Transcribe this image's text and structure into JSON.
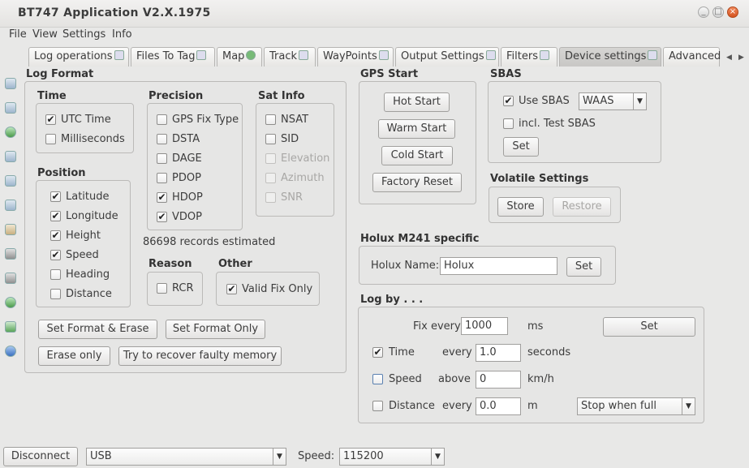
{
  "window": {
    "title": "BT747 Application V2.X.1975",
    "min": "_",
    "max": "□",
    "close": "×"
  },
  "menu": [
    "File",
    "View",
    "Settings",
    "Info"
  ],
  "tabs": [
    "Log operations",
    "Files To Tag",
    "Map",
    "Track",
    "WayPoints",
    "Output Settings",
    "Filters",
    "Device settings",
    "Advanced"
  ],
  "log_format": {
    "title": "Log Format",
    "time": {
      "title": "Time",
      "items": [
        {
          "label": "UTC Time",
          "checked": true
        },
        {
          "label": "Milliseconds",
          "checked": false
        }
      ]
    },
    "precision": {
      "title": "Precision",
      "items": [
        {
          "label": "GPS Fix Type",
          "checked": false
        },
        {
          "label": "DSTA",
          "checked": false
        },
        {
          "label": "DAGE",
          "checked": false
        },
        {
          "label": "PDOP",
          "checked": false
        },
        {
          "label": "HDOP",
          "checked": true
        },
        {
          "label": "VDOP",
          "checked": true
        }
      ]
    },
    "satinfo": {
      "title": "Sat Info",
      "items": [
        {
          "label": "NSAT",
          "checked": false,
          "disabled": false
        },
        {
          "label": "SID",
          "checked": false,
          "disabled": false
        },
        {
          "label": "Elevation",
          "checked": false,
          "disabled": true
        },
        {
          "label": "Azimuth",
          "checked": false,
          "disabled": true
        },
        {
          "label": "SNR",
          "checked": false,
          "disabled": true
        }
      ]
    },
    "position": {
      "title": "Position",
      "items": [
        {
          "label": "Latitude",
          "checked": true
        },
        {
          "label": "Longitude",
          "checked": true
        },
        {
          "label": "Height",
          "checked": true
        },
        {
          "label": "Speed",
          "checked": true
        },
        {
          "label": "Heading",
          "checked": false
        },
        {
          "label": "Distance",
          "checked": false
        }
      ]
    },
    "records": "86698 records estimated",
    "reason": {
      "title": "Reason",
      "items": [
        {
          "label": "RCR",
          "checked": false
        }
      ]
    },
    "other": {
      "title": "Other",
      "items": [
        {
          "label": "Valid Fix Only",
          "checked": true
        }
      ]
    },
    "buttons": {
      "set_format_erase": "Set Format & Erase",
      "set_format_only": "Set Format Only",
      "erase_only": "Erase only",
      "recover": "Try to recover faulty memory"
    }
  },
  "gps_start": {
    "title": "GPS Start",
    "hot": "Hot Start",
    "warm": "Warm Start",
    "cold": "Cold Start",
    "factory": "Factory Reset"
  },
  "sbas": {
    "title": "SBAS",
    "use_label": "Use SBAS",
    "use_checked": true,
    "mode": "WAAS",
    "test_label": "incl. Test SBAS",
    "test_checked": false,
    "set": "Set"
  },
  "volatile": {
    "title": "Volatile Settings",
    "store": "Store",
    "restore": "Restore"
  },
  "holux": {
    "title": "Holux M241 specific",
    "name_label": "Holux Name:",
    "name_value": "Holux",
    "set": "Set"
  },
  "logby": {
    "title": "Log by . . .",
    "fix_label": "Fix every",
    "fix_value": "1000",
    "fix_unit": "ms",
    "set": "Set",
    "time_label": "Time",
    "time_checked": true,
    "time_every": "every",
    "time_value": "1.0",
    "time_unit": "seconds",
    "speed_label": "Speed",
    "speed_checked": false,
    "speed_above": "above",
    "speed_value": "0",
    "speed_unit": "km/h",
    "distance_label": "Distance",
    "distance_checked": false,
    "distance_every": "every",
    "distance_value": "0.0",
    "distance_unit": "m",
    "when_full": "Stop when full"
  },
  "bottom": {
    "disconnect": "Disconnect",
    "port": "USB",
    "speed_label": "Speed:",
    "speed_value": "115200"
  }
}
